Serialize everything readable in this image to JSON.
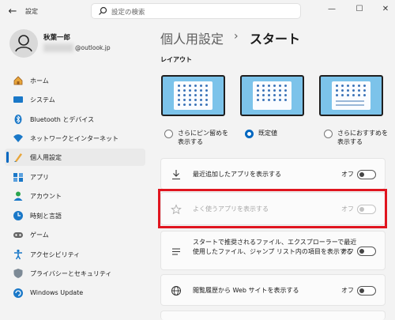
{
  "window": {
    "title": "設定",
    "back_icon": "back-arrow-icon",
    "controls": [
      "minimize-icon",
      "maximize-icon",
      "close-icon"
    ]
  },
  "search": {
    "placeholder": "設定の検索"
  },
  "user": {
    "name": "秋葉一郎",
    "email_suffix": "@outlook.jp"
  },
  "sidebar": {
    "items": [
      {
        "label": "ホーム",
        "icon": "home-icon"
      },
      {
        "label": "システム",
        "icon": "system-icon"
      },
      {
        "label": "Bluetooth とデバイス",
        "icon": "bluetooth-icon"
      },
      {
        "label": "ネットワークとインターネット",
        "icon": "network-icon"
      },
      {
        "label": "個人用設定",
        "icon": "personalization-icon",
        "active": true
      },
      {
        "label": "アプリ",
        "icon": "apps-icon"
      },
      {
        "label": "アカウント",
        "icon": "account-icon"
      },
      {
        "label": "時刻と言語",
        "icon": "time-language-icon"
      },
      {
        "label": "ゲーム",
        "icon": "gaming-icon"
      },
      {
        "label": "アクセシビリティ",
        "icon": "accessibility-icon"
      },
      {
        "label": "プライバシーとセキュリティ",
        "icon": "privacy-shield-icon"
      },
      {
        "label": "Windows Update",
        "icon": "windows-update-icon"
      }
    ]
  },
  "breadcrumb": {
    "parent": "個人用設定",
    "separator": "›",
    "current": "スタート"
  },
  "layout": {
    "heading": "レイアウト",
    "options": [
      {
        "label_line1": "さらにピン留めを",
        "label_line2": "表示する",
        "selected": false
      },
      {
        "label_line1": "既定値",
        "label_line2": "",
        "selected": true
      },
      {
        "label_line1": "さらにおすすめを",
        "label_line2": "表示する",
        "selected": false
      }
    ]
  },
  "settings": [
    {
      "label": "最近追加したアプリを表示する",
      "state": "オフ",
      "icon": "download-icon",
      "enabled": true
    },
    {
      "label": "よく使うアプリを表示する",
      "state": "オフ",
      "icon": "star-icon",
      "enabled": false,
      "highlighted": true
    },
    {
      "label_lines": [
        "スタートで推奨されるファイル、エクスプローラーで最近",
        "使用したファイル、ジャンプ リスト内の項目を表示する"
      ],
      "state": "オフ",
      "icon": "list-icon",
      "enabled": true
    },
    {
      "label": "閲覧履歴から Web サイトを表示する",
      "state": "オフ",
      "icon": "globe-icon",
      "enabled": true
    }
  ],
  "colors": {
    "accent": "#0067c0",
    "highlight": "#e0151f",
    "background": "#f3f3f3"
  }
}
